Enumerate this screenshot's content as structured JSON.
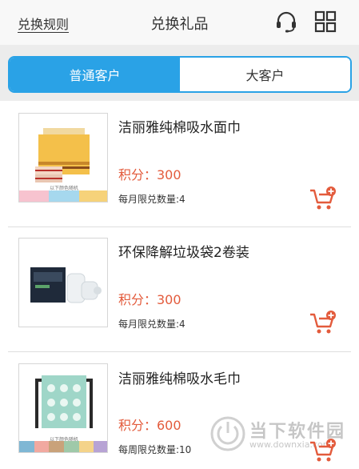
{
  "header": {
    "rules_label": "兑换规则",
    "title": "兑换礼品",
    "icons": [
      "headset-icon",
      "grid-icon"
    ]
  },
  "tabs": [
    {
      "label": "普通客户",
      "active": true
    },
    {
      "label": "大客户",
      "active": false
    }
  ],
  "products": [
    {
      "name": "洁丽雅纯棉吸水面巾",
      "points": "积分：300",
      "limit": "每月限兑数量:4",
      "thumb_caption": "以下颜色随机"
    },
    {
      "name": "环保降解垃圾袋2卷装",
      "points": "积分：300",
      "limit": "每月限兑数量:4"
    },
    {
      "name": "洁丽雅纯棉吸水毛巾",
      "points": "积分：600",
      "limit": "每周限兑数量:10",
      "thumb_caption": "以下颜色随机"
    }
  ],
  "watermark": {
    "title": "当下软件园",
    "url": "www.downxia.com"
  },
  "colors": {
    "accent": "#2aa2e6",
    "points": "#e35b3c",
    "cart": "#e35b3c"
  }
}
